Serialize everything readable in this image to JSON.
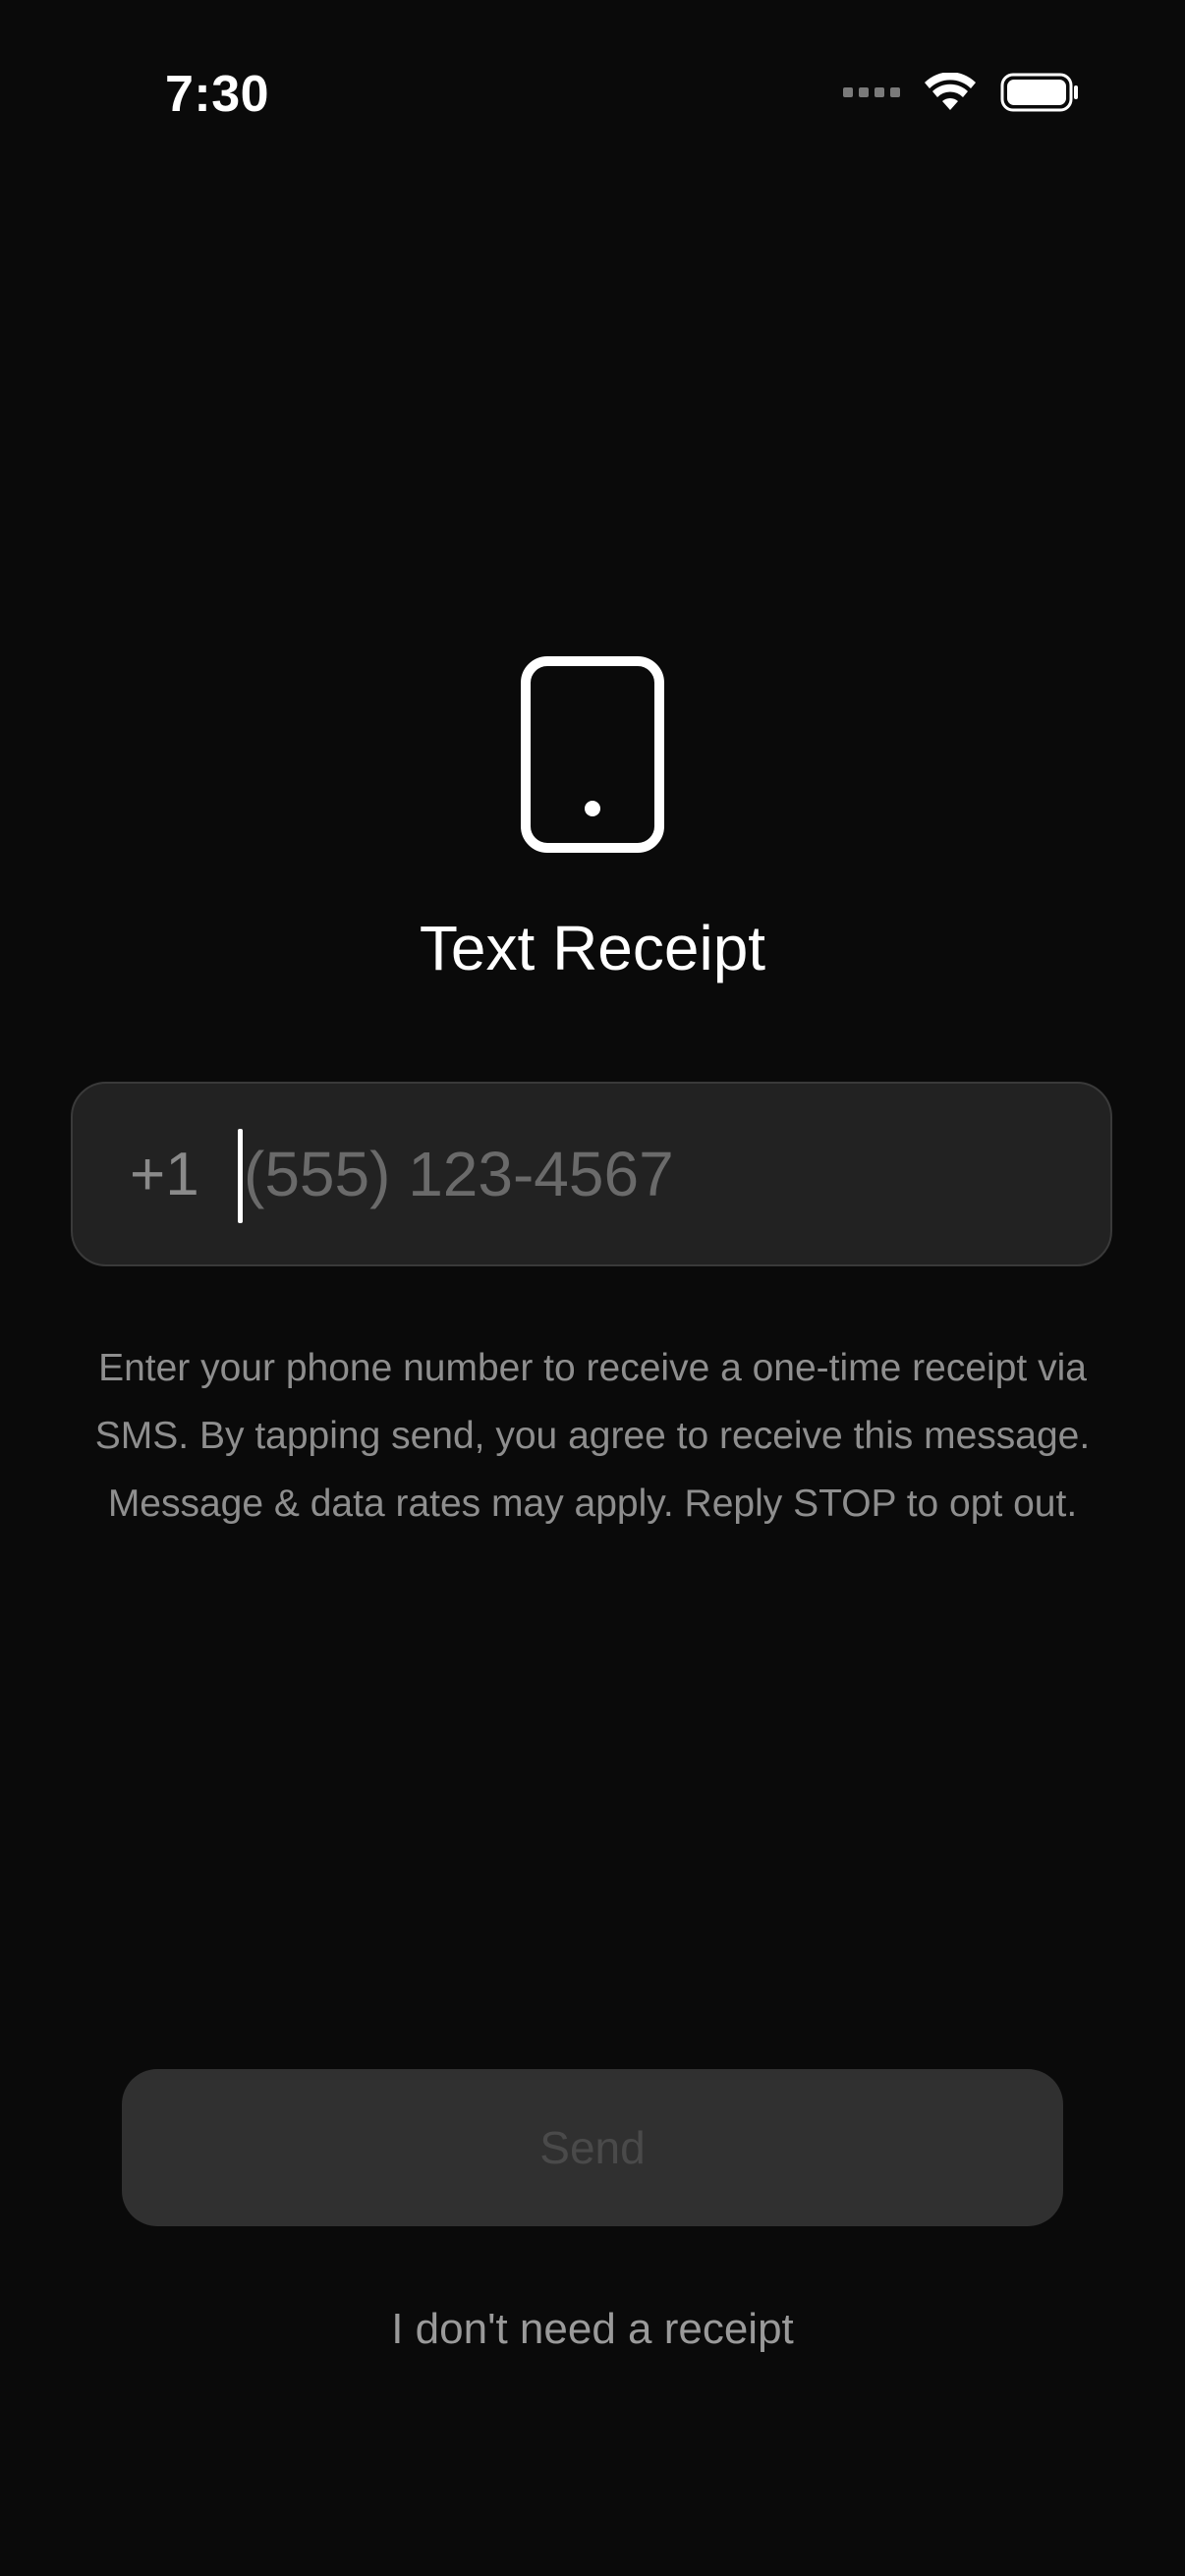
{
  "status_bar": {
    "time": "7:30",
    "icons": [
      "cellular-signal-icon",
      "wifi-icon",
      "battery-icon"
    ]
  },
  "hero": {
    "icon": "phone-icon",
    "title": "Text Receipt"
  },
  "phone_field": {
    "country_code": "+1",
    "value": "",
    "placeholder": "(555) 123-4567"
  },
  "disclaimer": "Enter your phone number to receive a one-time receipt via SMS. By tapping send, you agree to receive this message. Message & data rates may apply. Reply STOP to opt out.",
  "actions": {
    "send_label": "Send",
    "skip_label": "I don't need a receipt"
  },
  "colors": {
    "background": "#0a0a0a",
    "field_background": "#222222",
    "button_disabled": "#303030",
    "text_primary": "#ffffff",
    "text_secondary": "#8e8e8e"
  }
}
